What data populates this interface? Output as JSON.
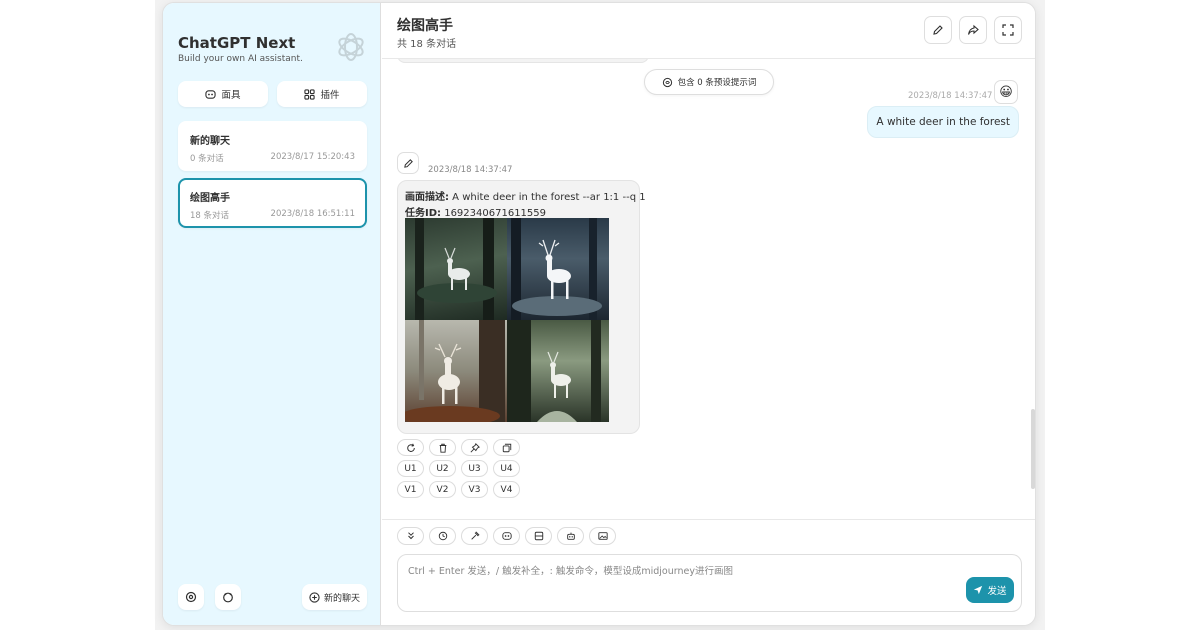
{
  "sidebar": {
    "title": "ChatGPT Next",
    "subtitle": "Build your own AI assistant.",
    "logo_icon": "openai-logo-icon",
    "mask_button": {
      "icon": "mask-icon",
      "label": "面具"
    },
    "plugin_button": {
      "icon": "plugin-grid-icon",
      "label": "插件"
    },
    "chats": [
      {
        "title": "新的聊天",
        "count": "0 条对话",
        "time": "2023/8/17 15:20:43",
        "active": false
      },
      {
        "title": "绘图高手",
        "count": "18 条对话",
        "time": "2023/8/18 16:51:11",
        "active": true
      }
    ],
    "settings_icon": "settings-icon",
    "github_icon": "github-icon",
    "new_chat": {
      "icon": "add-circle-icon",
      "label": "新的聊天"
    }
  },
  "header": {
    "title": "绘图高手",
    "subtitle": "共 18 条对话",
    "edit_icon": "edit-icon",
    "share_icon": "share-icon",
    "fullscreen_icon": "fullscreen-icon"
  },
  "context": {
    "label": "包含 0 条预设提示词",
    "icon": "brain-icon"
  },
  "user_message": {
    "time": "2023/8/18 14:37:47",
    "avatar": "😀",
    "text": "A white deer in the forest"
  },
  "bot_message": {
    "time": "2023/8/18 14:37:47",
    "desc_label": "画面描述:",
    "desc_value": " A white deer in the forest --ar 1:1 --q 1",
    "task_label": "任务ID:",
    "task_value": " 1692340671611559",
    "image_alt": "white deer in the forest grid"
  },
  "message_actions": [
    "refresh-icon",
    "delete-icon",
    "pin-icon",
    "copy-icon"
  ],
  "upscale_buttons": [
    "U1",
    "U2",
    "U3",
    "U4"
  ],
  "variation_buttons": [
    "V1",
    "V2",
    "V3",
    "V4"
  ],
  "input": {
    "placeholder": "Ctrl + Enter 发送，/ 触发补全，: 触发命令，模型设成midjourney进行画图",
    "value": "",
    "send_label": "发送",
    "send_icon": "send-icon",
    "tools": [
      "scroll-bottom-icon",
      "settings-icon",
      "prompt-icon",
      "mask-icon",
      "clear-context-icon",
      "model-robot-icon",
      "image-icon"
    ]
  },
  "colors": {
    "accent": "#1d93ab",
    "sidebar_bg": "#e7f8ff",
    "user_bubble": "#e7f8ff"
  }
}
